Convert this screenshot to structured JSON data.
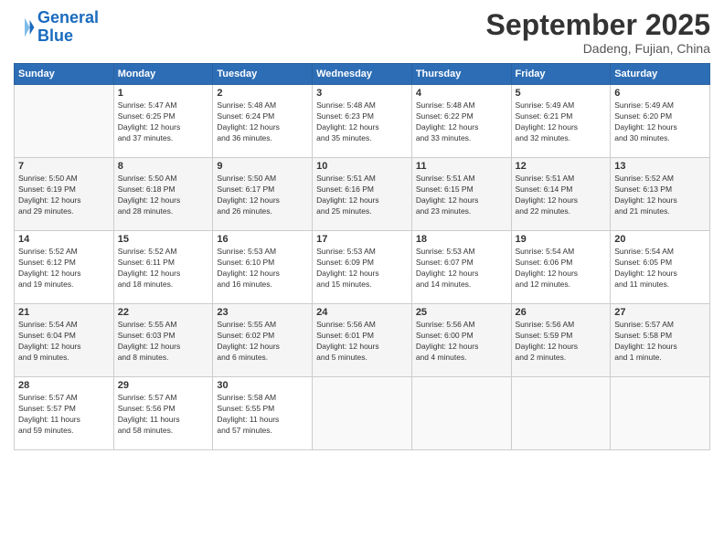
{
  "header": {
    "logo_line1": "General",
    "logo_line2": "Blue",
    "title": "September 2025",
    "location": "Dadeng, Fujian, China"
  },
  "days_of_week": [
    "Sunday",
    "Monday",
    "Tuesday",
    "Wednesday",
    "Thursday",
    "Friday",
    "Saturday"
  ],
  "weeks": [
    [
      {
        "day": "",
        "info": ""
      },
      {
        "day": "1",
        "info": "Sunrise: 5:47 AM\nSunset: 6:25 PM\nDaylight: 12 hours\nand 37 minutes."
      },
      {
        "day": "2",
        "info": "Sunrise: 5:48 AM\nSunset: 6:24 PM\nDaylight: 12 hours\nand 36 minutes."
      },
      {
        "day": "3",
        "info": "Sunrise: 5:48 AM\nSunset: 6:23 PM\nDaylight: 12 hours\nand 35 minutes."
      },
      {
        "day": "4",
        "info": "Sunrise: 5:48 AM\nSunset: 6:22 PM\nDaylight: 12 hours\nand 33 minutes."
      },
      {
        "day": "5",
        "info": "Sunrise: 5:49 AM\nSunset: 6:21 PM\nDaylight: 12 hours\nand 32 minutes."
      },
      {
        "day": "6",
        "info": "Sunrise: 5:49 AM\nSunset: 6:20 PM\nDaylight: 12 hours\nand 30 minutes."
      }
    ],
    [
      {
        "day": "7",
        "info": "Sunrise: 5:50 AM\nSunset: 6:19 PM\nDaylight: 12 hours\nand 29 minutes."
      },
      {
        "day": "8",
        "info": "Sunrise: 5:50 AM\nSunset: 6:18 PM\nDaylight: 12 hours\nand 28 minutes."
      },
      {
        "day": "9",
        "info": "Sunrise: 5:50 AM\nSunset: 6:17 PM\nDaylight: 12 hours\nand 26 minutes."
      },
      {
        "day": "10",
        "info": "Sunrise: 5:51 AM\nSunset: 6:16 PM\nDaylight: 12 hours\nand 25 minutes."
      },
      {
        "day": "11",
        "info": "Sunrise: 5:51 AM\nSunset: 6:15 PM\nDaylight: 12 hours\nand 23 minutes."
      },
      {
        "day": "12",
        "info": "Sunrise: 5:51 AM\nSunset: 6:14 PM\nDaylight: 12 hours\nand 22 minutes."
      },
      {
        "day": "13",
        "info": "Sunrise: 5:52 AM\nSunset: 6:13 PM\nDaylight: 12 hours\nand 21 minutes."
      }
    ],
    [
      {
        "day": "14",
        "info": "Sunrise: 5:52 AM\nSunset: 6:12 PM\nDaylight: 12 hours\nand 19 minutes."
      },
      {
        "day": "15",
        "info": "Sunrise: 5:52 AM\nSunset: 6:11 PM\nDaylight: 12 hours\nand 18 minutes."
      },
      {
        "day": "16",
        "info": "Sunrise: 5:53 AM\nSunset: 6:10 PM\nDaylight: 12 hours\nand 16 minutes."
      },
      {
        "day": "17",
        "info": "Sunrise: 5:53 AM\nSunset: 6:09 PM\nDaylight: 12 hours\nand 15 minutes."
      },
      {
        "day": "18",
        "info": "Sunrise: 5:53 AM\nSunset: 6:07 PM\nDaylight: 12 hours\nand 14 minutes."
      },
      {
        "day": "19",
        "info": "Sunrise: 5:54 AM\nSunset: 6:06 PM\nDaylight: 12 hours\nand 12 minutes."
      },
      {
        "day": "20",
        "info": "Sunrise: 5:54 AM\nSunset: 6:05 PM\nDaylight: 12 hours\nand 11 minutes."
      }
    ],
    [
      {
        "day": "21",
        "info": "Sunrise: 5:54 AM\nSunset: 6:04 PM\nDaylight: 12 hours\nand 9 minutes."
      },
      {
        "day": "22",
        "info": "Sunrise: 5:55 AM\nSunset: 6:03 PM\nDaylight: 12 hours\nand 8 minutes."
      },
      {
        "day": "23",
        "info": "Sunrise: 5:55 AM\nSunset: 6:02 PM\nDaylight: 12 hours\nand 6 minutes."
      },
      {
        "day": "24",
        "info": "Sunrise: 5:56 AM\nSunset: 6:01 PM\nDaylight: 12 hours\nand 5 minutes."
      },
      {
        "day": "25",
        "info": "Sunrise: 5:56 AM\nSunset: 6:00 PM\nDaylight: 12 hours\nand 4 minutes."
      },
      {
        "day": "26",
        "info": "Sunrise: 5:56 AM\nSunset: 5:59 PM\nDaylight: 12 hours\nand 2 minutes."
      },
      {
        "day": "27",
        "info": "Sunrise: 5:57 AM\nSunset: 5:58 PM\nDaylight: 12 hours\nand 1 minute."
      }
    ],
    [
      {
        "day": "28",
        "info": "Sunrise: 5:57 AM\nSunset: 5:57 PM\nDaylight: 11 hours\nand 59 minutes."
      },
      {
        "day": "29",
        "info": "Sunrise: 5:57 AM\nSunset: 5:56 PM\nDaylight: 11 hours\nand 58 minutes."
      },
      {
        "day": "30",
        "info": "Sunrise: 5:58 AM\nSunset: 5:55 PM\nDaylight: 11 hours\nand 57 minutes."
      },
      {
        "day": "",
        "info": ""
      },
      {
        "day": "",
        "info": ""
      },
      {
        "day": "",
        "info": ""
      },
      {
        "day": "",
        "info": ""
      }
    ]
  ]
}
